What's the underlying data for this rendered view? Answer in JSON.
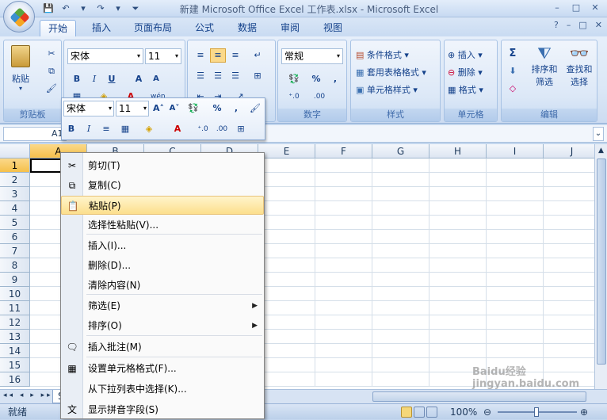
{
  "window": {
    "title": "新建 Microsoft Office Excel 工作表.xlsx - Microsoft Excel",
    "minimize": "–",
    "restore": "□",
    "close": "✕"
  },
  "tabs": [
    "开始",
    "插入",
    "页面布局",
    "公式",
    "数据",
    "审阅",
    "视图"
  ],
  "active_tab": "开始",
  "help_icons": [
    "?",
    "–",
    "□",
    "✕"
  ],
  "ribbon": {
    "clipboard": {
      "label": "剪贴板",
      "paste": "粘贴"
    },
    "font": {
      "name": "宋体",
      "size": "11",
      "bold": "B",
      "italic": "I",
      "underline": "U",
      "grow": "A",
      "shrink": "A"
    },
    "alignment": {},
    "number": {
      "label": "数字",
      "format": "常规",
      "percent": "%",
      "comma": ","
    },
    "styles": {
      "label": "样式",
      "conditional": "条件格式",
      "table": "套用表格格式",
      "cell": "单元格样式"
    },
    "cells": {
      "label": "单元格",
      "insert": "插入",
      "delete": "删除",
      "format": "格式"
    },
    "editing": {
      "label": "编辑",
      "sort": "排序和",
      "sort2": "筛选",
      "find": "查找和",
      "find2": "选择",
      "sigma": "Σ"
    }
  },
  "formula_bar": {
    "name": "A1"
  },
  "columns": [
    "A",
    "B",
    "C",
    "D",
    "E",
    "F",
    "G",
    "H",
    "I",
    "J"
  ],
  "rows": [
    "1",
    "2",
    "3",
    "4",
    "5",
    "6",
    "7",
    "8",
    "9",
    "10",
    "11",
    "12",
    "13",
    "14",
    "15",
    "16"
  ],
  "mini_toolbar": {
    "font": "宋体",
    "size": "11",
    "bold": "B",
    "italic": "I",
    "percent": "%",
    "comma": ","
  },
  "context_menu": [
    {
      "label": "剪切(T)",
      "icon": "✂"
    },
    {
      "label": "复制(C)",
      "icon": "⧉"
    },
    {
      "label": "粘贴(P)",
      "icon": "📋",
      "highlight": true
    },
    {
      "label": "选择性粘贴(V)...",
      "icon": ""
    },
    {
      "label": "插入(I)...",
      "icon": ""
    },
    {
      "label": "删除(D)...",
      "icon": ""
    },
    {
      "label": "清除内容(N)",
      "icon": ""
    },
    {
      "label": "筛选(E)",
      "icon": "",
      "submenu": true
    },
    {
      "label": "排序(O)",
      "icon": "",
      "submenu": true
    },
    {
      "label": "插入批注(M)",
      "icon": "🗨"
    },
    {
      "label": "设置单元格格式(F)...",
      "icon": "▦"
    },
    {
      "label": "从下拉列表中选择(K)...",
      "icon": ""
    },
    {
      "label": "显示拼音字段(S)",
      "icon": "文"
    }
  ],
  "status": {
    "ready": "就绪",
    "zoom": "100%"
  },
  "sheet_tab": "S",
  "watermark": "Baidu经验 jingyan.baidu.com"
}
